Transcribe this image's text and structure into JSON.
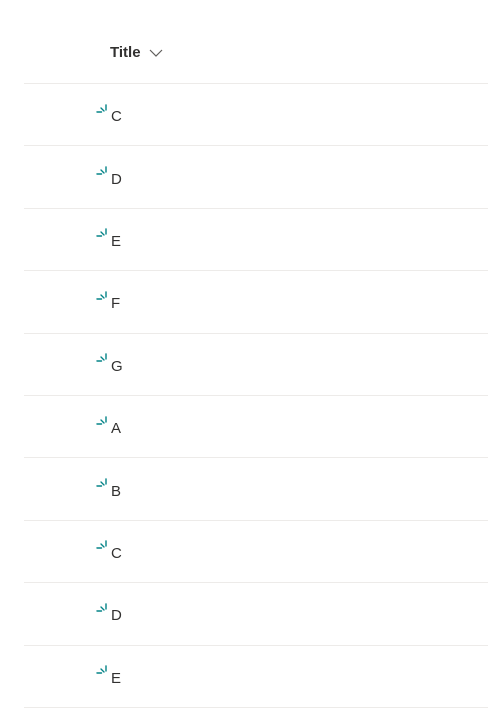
{
  "header": {
    "title_label": "Title"
  },
  "icons": {
    "new_item": "new-item-sparkle-icon",
    "sort": "chevron-down-icon"
  },
  "colors": {
    "accent": "#038387",
    "divider": "#edebe9",
    "text": "#323130"
  },
  "rows": [
    {
      "title": "C"
    },
    {
      "title": "D"
    },
    {
      "title": "E"
    },
    {
      "title": "F"
    },
    {
      "title": "G"
    },
    {
      "title": "A"
    },
    {
      "title": "B"
    },
    {
      "title": "C"
    },
    {
      "title": "D"
    },
    {
      "title": "E"
    }
  ]
}
